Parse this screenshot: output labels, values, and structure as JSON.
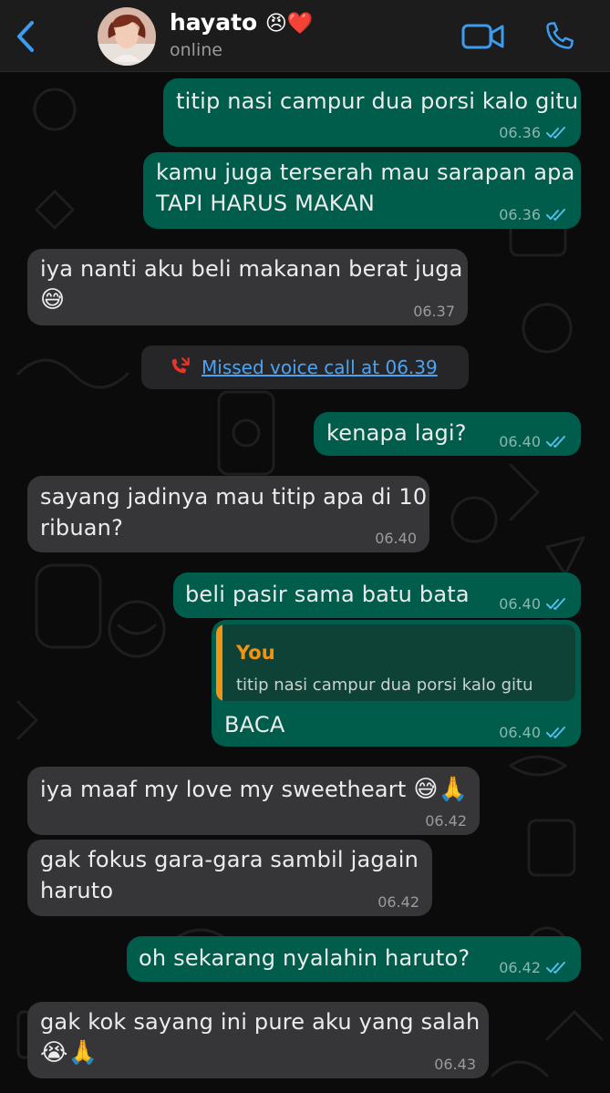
{
  "header": {
    "name": "hayato",
    "name_emojis": "😠❤️",
    "status": "online",
    "back_icon": "chevron-left-icon",
    "video_icon": "video-camera-icon",
    "call_icon": "phone-icon"
  },
  "colors": {
    "accent": "#4aa3f5",
    "outgoing_bubble": "#005c4b",
    "incoming_bubble": "#363638",
    "quote_author": "#f29413",
    "missed_call": "#e5362c"
  },
  "messages": [
    {
      "text": "titip nasi campur dua porsi kalo gitu",
      "time": "06.36",
      "direction": "out"
    },
    {
      "text": "kamu juga terserah mau sarapan apa",
      "text2": "TAPI HARUS MAKAN",
      "time": "06.36",
      "direction": "out"
    },
    {
      "text": "iya nanti aku beli makanan berat juga",
      "emoji": "😅",
      "time": "06.37",
      "direction": "in"
    },
    {
      "text": "kenapa lagi?",
      "time": "06.40",
      "direction": "out"
    },
    {
      "text": "sayang jadinya mau titip apa di 10",
      "text2": "ribuan?",
      "time": "06.40",
      "direction": "in"
    },
    {
      "text": "beli pasir sama batu bata",
      "time": "06.40",
      "direction": "out"
    },
    {
      "text": "BACA",
      "time": "06.40",
      "direction": "out",
      "quote": {
        "author": "You",
        "text": "titip nasi campur dua porsi kalo gitu"
      }
    },
    {
      "text": "iya maaf my love my sweetheart",
      "emoji": "😅🙏",
      "time": "06.42",
      "direction": "in"
    },
    {
      "text": "gak fokus gara-gara sambil jagain",
      "text2": "haruto",
      "time": "06.42",
      "direction": "in"
    },
    {
      "text": "oh sekarang nyalahin haruto?",
      "time": "06.42",
      "direction": "out"
    },
    {
      "text": "gak kok sayang ini pure aku yang salah",
      "emoji": "😭🙏",
      "time": "06.43",
      "direction": "in"
    }
  ],
  "system_message": {
    "text": "Missed voice call at 06.39",
    "icon": "missed-call-icon"
  }
}
